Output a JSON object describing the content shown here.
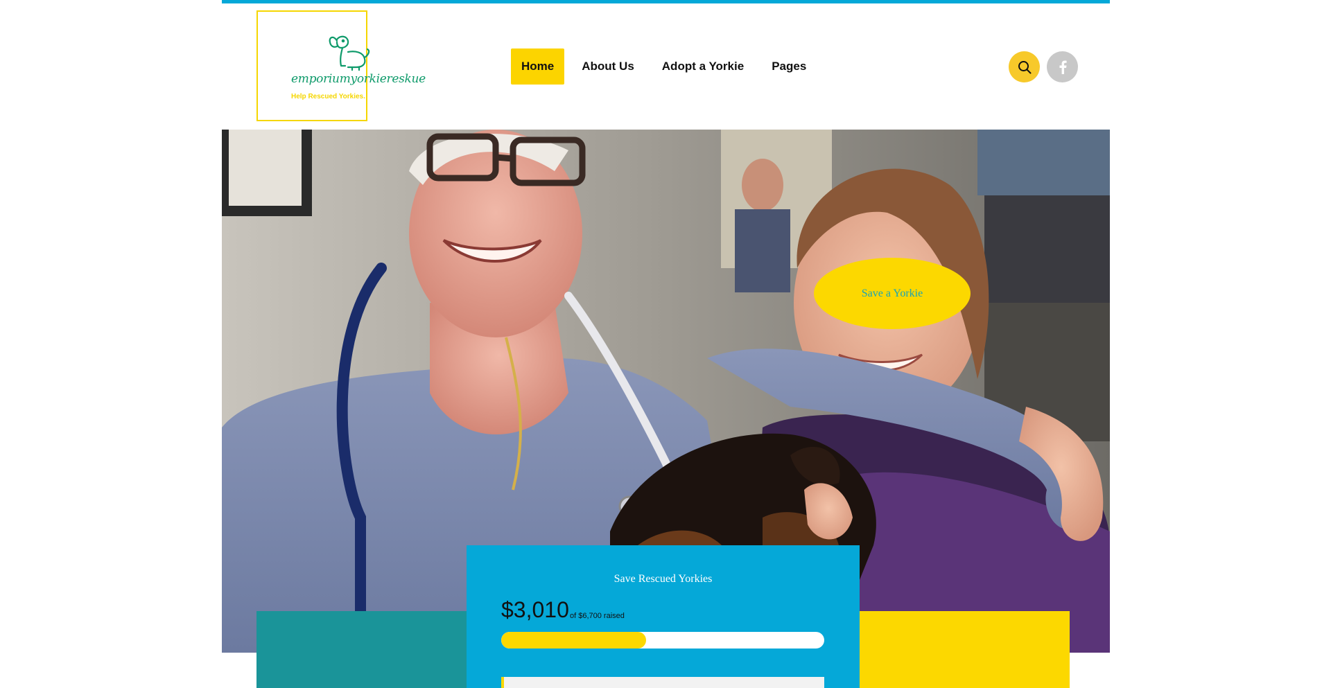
{
  "brand": {
    "name": "emporiumyorkiereskue",
    "tagline": "Help Rescued Yorkies.",
    "colors": {
      "accent_blue": "#05a8d8",
      "accent_yellow": "#fcd800",
      "logo_green": "#0e9a6a",
      "teal": "#1a9499"
    }
  },
  "nav": {
    "items": [
      {
        "label": "Home",
        "active": true
      },
      {
        "label": "About Us",
        "active": false
      },
      {
        "label": "Adopt a Yorkie",
        "active": false
      },
      {
        "label": "Pages",
        "active": false
      }
    ]
  },
  "header_icons": {
    "search": "search-icon",
    "facebook": "facebook-icon"
  },
  "hero": {
    "cta_label": "Save a Yorkie"
  },
  "donation": {
    "title": "Save Rescued Yorkies",
    "raised": "$3,010",
    "goal_text": "of $6,700 raised",
    "progress_fraction": 0.449
  }
}
